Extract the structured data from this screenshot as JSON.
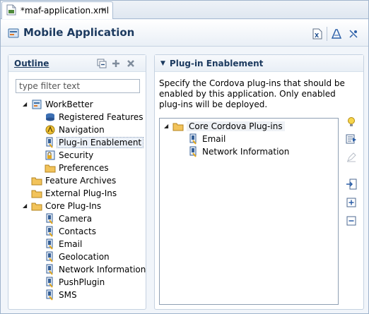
{
  "tab": {
    "label": "*maf-application.xml",
    "close": "✕"
  },
  "header": {
    "title": "Mobile Application"
  },
  "outline": {
    "title": "Outline",
    "filter_placeholder": "type filter text",
    "tree": [
      {
        "label": "WorkBetter",
        "icon": "application-icon",
        "level": 1,
        "expanded": true
      },
      {
        "label": "Registered Features",
        "icon": "features-icon",
        "level": 2
      },
      {
        "label": "Navigation",
        "icon": "navigation-icon",
        "level": 2
      },
      {
        "label": "Plug-in Enablement",
        "icon": "plugin-icon",
        "level": 2,
        "selected": true
      },
      {
        "label": "Security",
        "icon": "security-icon",
        "level": 2
      },
      {
        "label": "Preferences",
        "icon": "folder-icon",
        "level": 2
      },
      {
        "label": "Feature Archives",
        "icon": "folder-icon",
        "level": 1
      },
      {
        "label": "External Plug-Ins",
        "icon": "folder-icon",
        "level": 1
      },
      {
        "label": "Core Plug-Ins",
        "icon": "folder-icon",
        "level": 1,
        "expanded": true
      },
      {
        "label": "Camera",
        "icon": "plugin-icon",
        "level": 2
      },
      {
        "label": "Contacts",
        "icon": "plugin-icon",
        "level": 2
      },
      {
        "label": "Email",
        "icon": "plugin-icon",
        "level": 2
      },
      {
        "label": "Geolocation",
        "icon": "plugin-icon",
        "level": 2
      },
      {
        "label": "Network Information",
        "icon": "plugin-icon",
        "level": 2
      },
      {
        "label": "PushPlugin",
        "icon": "plugin-icon",
        "level": 2
      },
      {
        "label": "SMS",
        "icon": "plugin-icon",
        "level": 2
      }
    ]
  },
  "plugin_panel": {
    "title": "Plug-in Enablement",
    "description": "Specify the Cordova plug-ins that should be enabled by this application.  Only enabled plug-ins will be deployed.",
    "tree": [
      {
        "label": "Core Cordova Plug-ins",
        "icon": "folder-icon",
        "level": 1,
        "expanded": true,
        "highlighted": true
      },
      {
        "label": "Email",
        "icon": "plugin-icon",
        "level": 2
      },
      {
        "label": "Network Information",
        "icon": "plugin-icon",
        "level": 2
      }
    ]
  },
  "colors": {
    "accent": "#1c3a5f",
    "panel_border": "#c5d2e1",
    "folder": "#f2c35a"
  }
}
